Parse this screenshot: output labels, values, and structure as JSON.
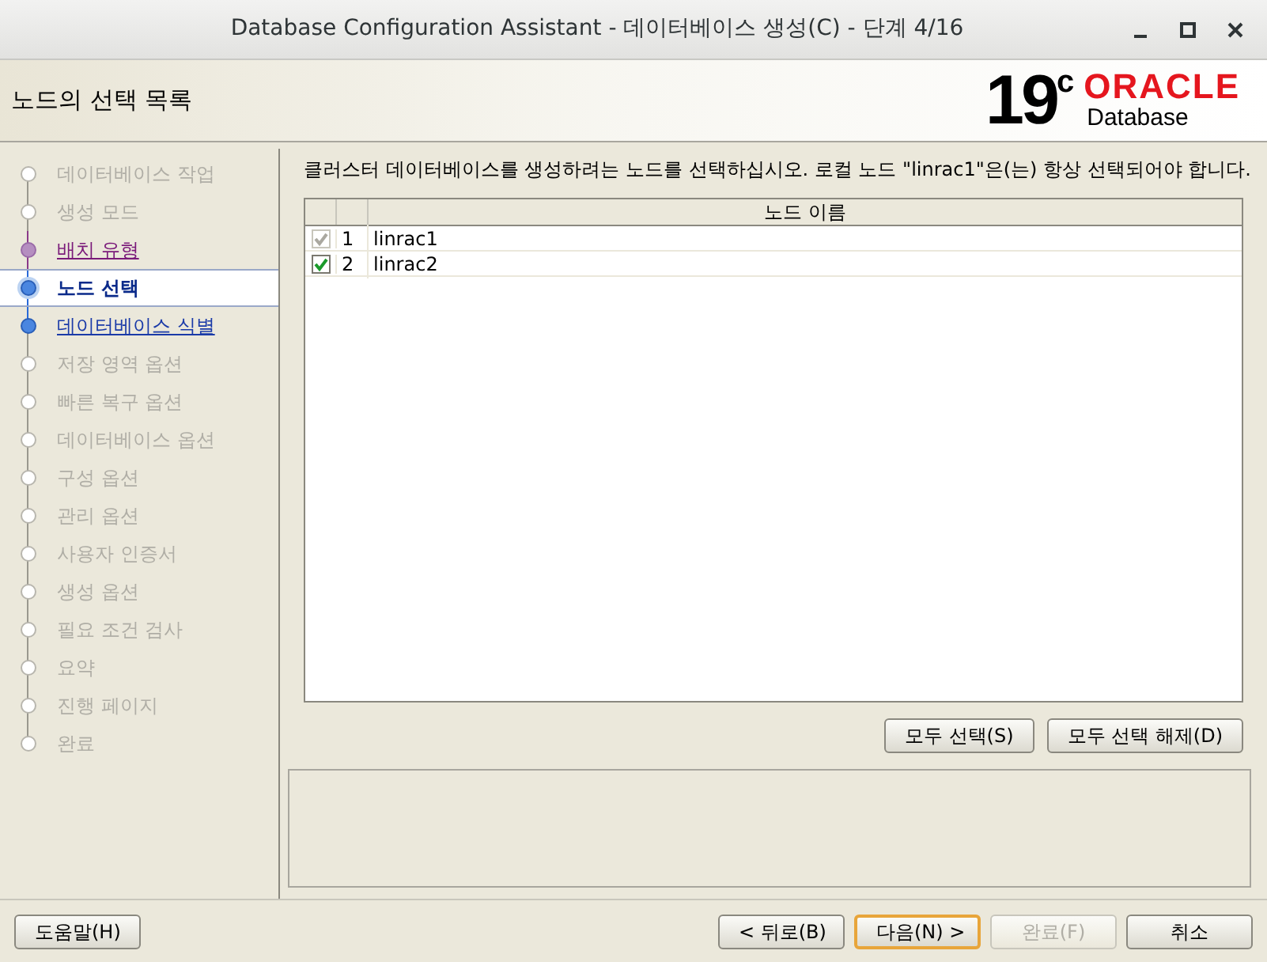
{
  "window": {
    "title": "Database Configuration Assistant - 데이터베이스 생성(C) - 단계 4/16"
  },
  "header": {
    "title": "노드의 선택 목록",
    "logo_version": "19",
    "logo_sup": "c",
    "logo_brand": "ORACLE",
    "logo_product": "Database"
  },
  "steps": [
    {
      "label": "데이터베이스 작업",
      "kind": "disabled"
    },
    {
      "label": "생성 모드",
      "kind": "disabled"
    },
    {
      "label": "배치 유형",
      "kind": "visited"
    },
    {
      "label": "노드 선택",
      "kind": "current"
    },
    {
      "label": "데이터베이스 식별",
      "kind": "next"
    },
    {
      "label": "저장 영역 옵션",
      "kind": "disabled"
    },
    {
      "label": "빠른 복구 옵션",
      "kind": "disabled"
    },
    {
      "label": "데이터베이스 옵션",
      "kind": "disabled"
    },
    {
      "label": "구성 옵션",
      "kind": "disabled"
    },
    {
      "label": "관리 옵션",
      "kind": "disabled"
    },
    {
      "label": "사용자 인증서",
      "kind": "disabled"
    },
    {
      "label": "생성 옵션",
      "kind": "disabled"
    },
    {
      "label": "필요 조건 검사",
      "kind": "disabled"
    },
    {
      "label": "요약",
      "kind": "disabled"
    },
    {
      "label": "진행 페이지",
      "kind": "disabled"
    },
    {
      "label": "완료",
      "kind": "disabled"
    }
  ],
  "instruction": "클러스터 데이터베이스를 생성하려는 노드를 선택하십시오. 로컬 노드 \"linrac1\"은(는) 항상 선택되어야 합니다.",
  "table": {
    "columns": [
      "노드 이름"
    ],
    "rows": [
      {
        "number": "1",
        "name": "linrac1",
        "checked": true,
        "disabled": true
      },
      {
        "number": "2",
        "name": "linrac2",
        "checked": true,
        "disabled": false
      }
    ]
  },
  "table_buttons": [
    {
      "label": "모두 선택(S)"
    },
    {
      "label": "모두 선택 해제(D)"
    }
  ],
  "footer": {
    "help": {
      "label": "도움말(H)"
    },
    "nav": [
      {
        "label": "< 뒤로(B)",
        "disabled": false,
        "default": false
      },
      {
        "label": "다음(N) >",
        "disabled": false,
        "default": true
      },
      {
        "label": "완료(F)",
        "disabled": true,
        "default": false
      },
      {
        "label": "취소",
        "disabled": false,
        "default": false
      }
    ]
  }
}
